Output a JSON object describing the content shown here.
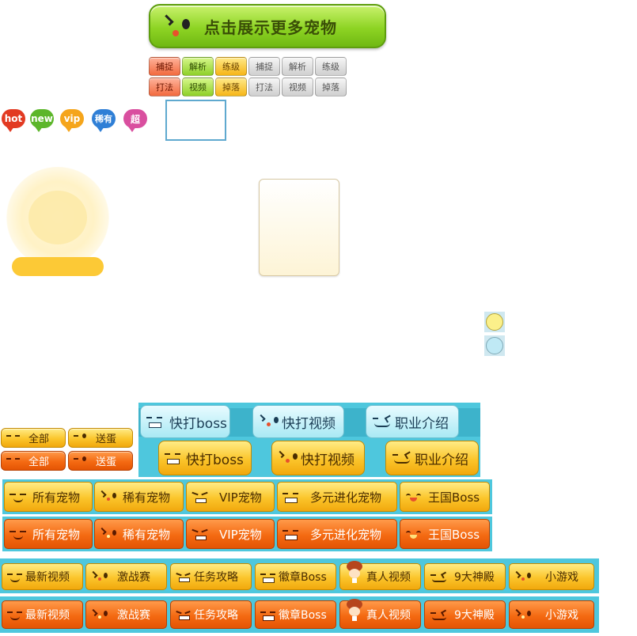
{
  "top_button": {
    "label": "点击展示更多宠物"
  },
  "tag_grid": {
    "row1": [
      "捕捉",
      "解析",
      "练级",
      "捕捉",
      "解析",
      "练级"
    ],
    "row2": [
      "打法",
      "视频",
      "掉落",
      "打法",
      "视频",
      "掉落"
    ]
  },
  "badges": [
    {
      "label": "hot",
      "color": "#e23a22"
    },
    {
      "label": "new",
      "color": "#5cb62a"
    },
    {
      "label": "vip",
      "color": "#f5a51b"
    },
    {
      "label": "稀有",
      "color": "#2f7fd6"
    },
    {
      "label": "超",
      "color": "#d94f9f"
    }
  ],
  "small_filters": {
    "row1": [
      "全部",
      "送蛋"
    ],
    "row2": [
      "全部",
      "送蛋"
    ]
  },
  "feature_buttons": {
    "row1": [
      "快打boss",
      "快打视频",
      "职业介绍"
    ],
    "row2": [
      "快打boss",
      "快打视频",
      "职业介绍"
    ]
  },
  "pet_categories": {
    "row1": [
      "所有宠物",
      "稀有宠物",
      "VIP宠物",
      "多元进化宠物",
      "王国Boss"
    ],
    "row2": [
      "所有宠物",
      "稀有宠物",
      "VIP宠物",
      "多元进化宠物",
      "王国Boss"
    ]
  },
  "nav_buttons": {
    "row1": [
      "最新视频",
      "激战赛",
      "任务攻略",
      "徽章Boss",
      "真人视频",
      "9大神殿",
      "小游戏"
    ],
    "row2": [
      "最新视频",
      "激战赛",
      "任务攻略",
      "徽章Boss",
      "真人视频",
      "9大神殿",
      "小游戏"
    ]
  },
  "colors": {
    "accent_green": "#8ed424",
    "accent_yellow": "#fbc52b",
    "accent_orange": "#f46a12",
    "accent_cyan": "#4ec7dd"
  }
}
